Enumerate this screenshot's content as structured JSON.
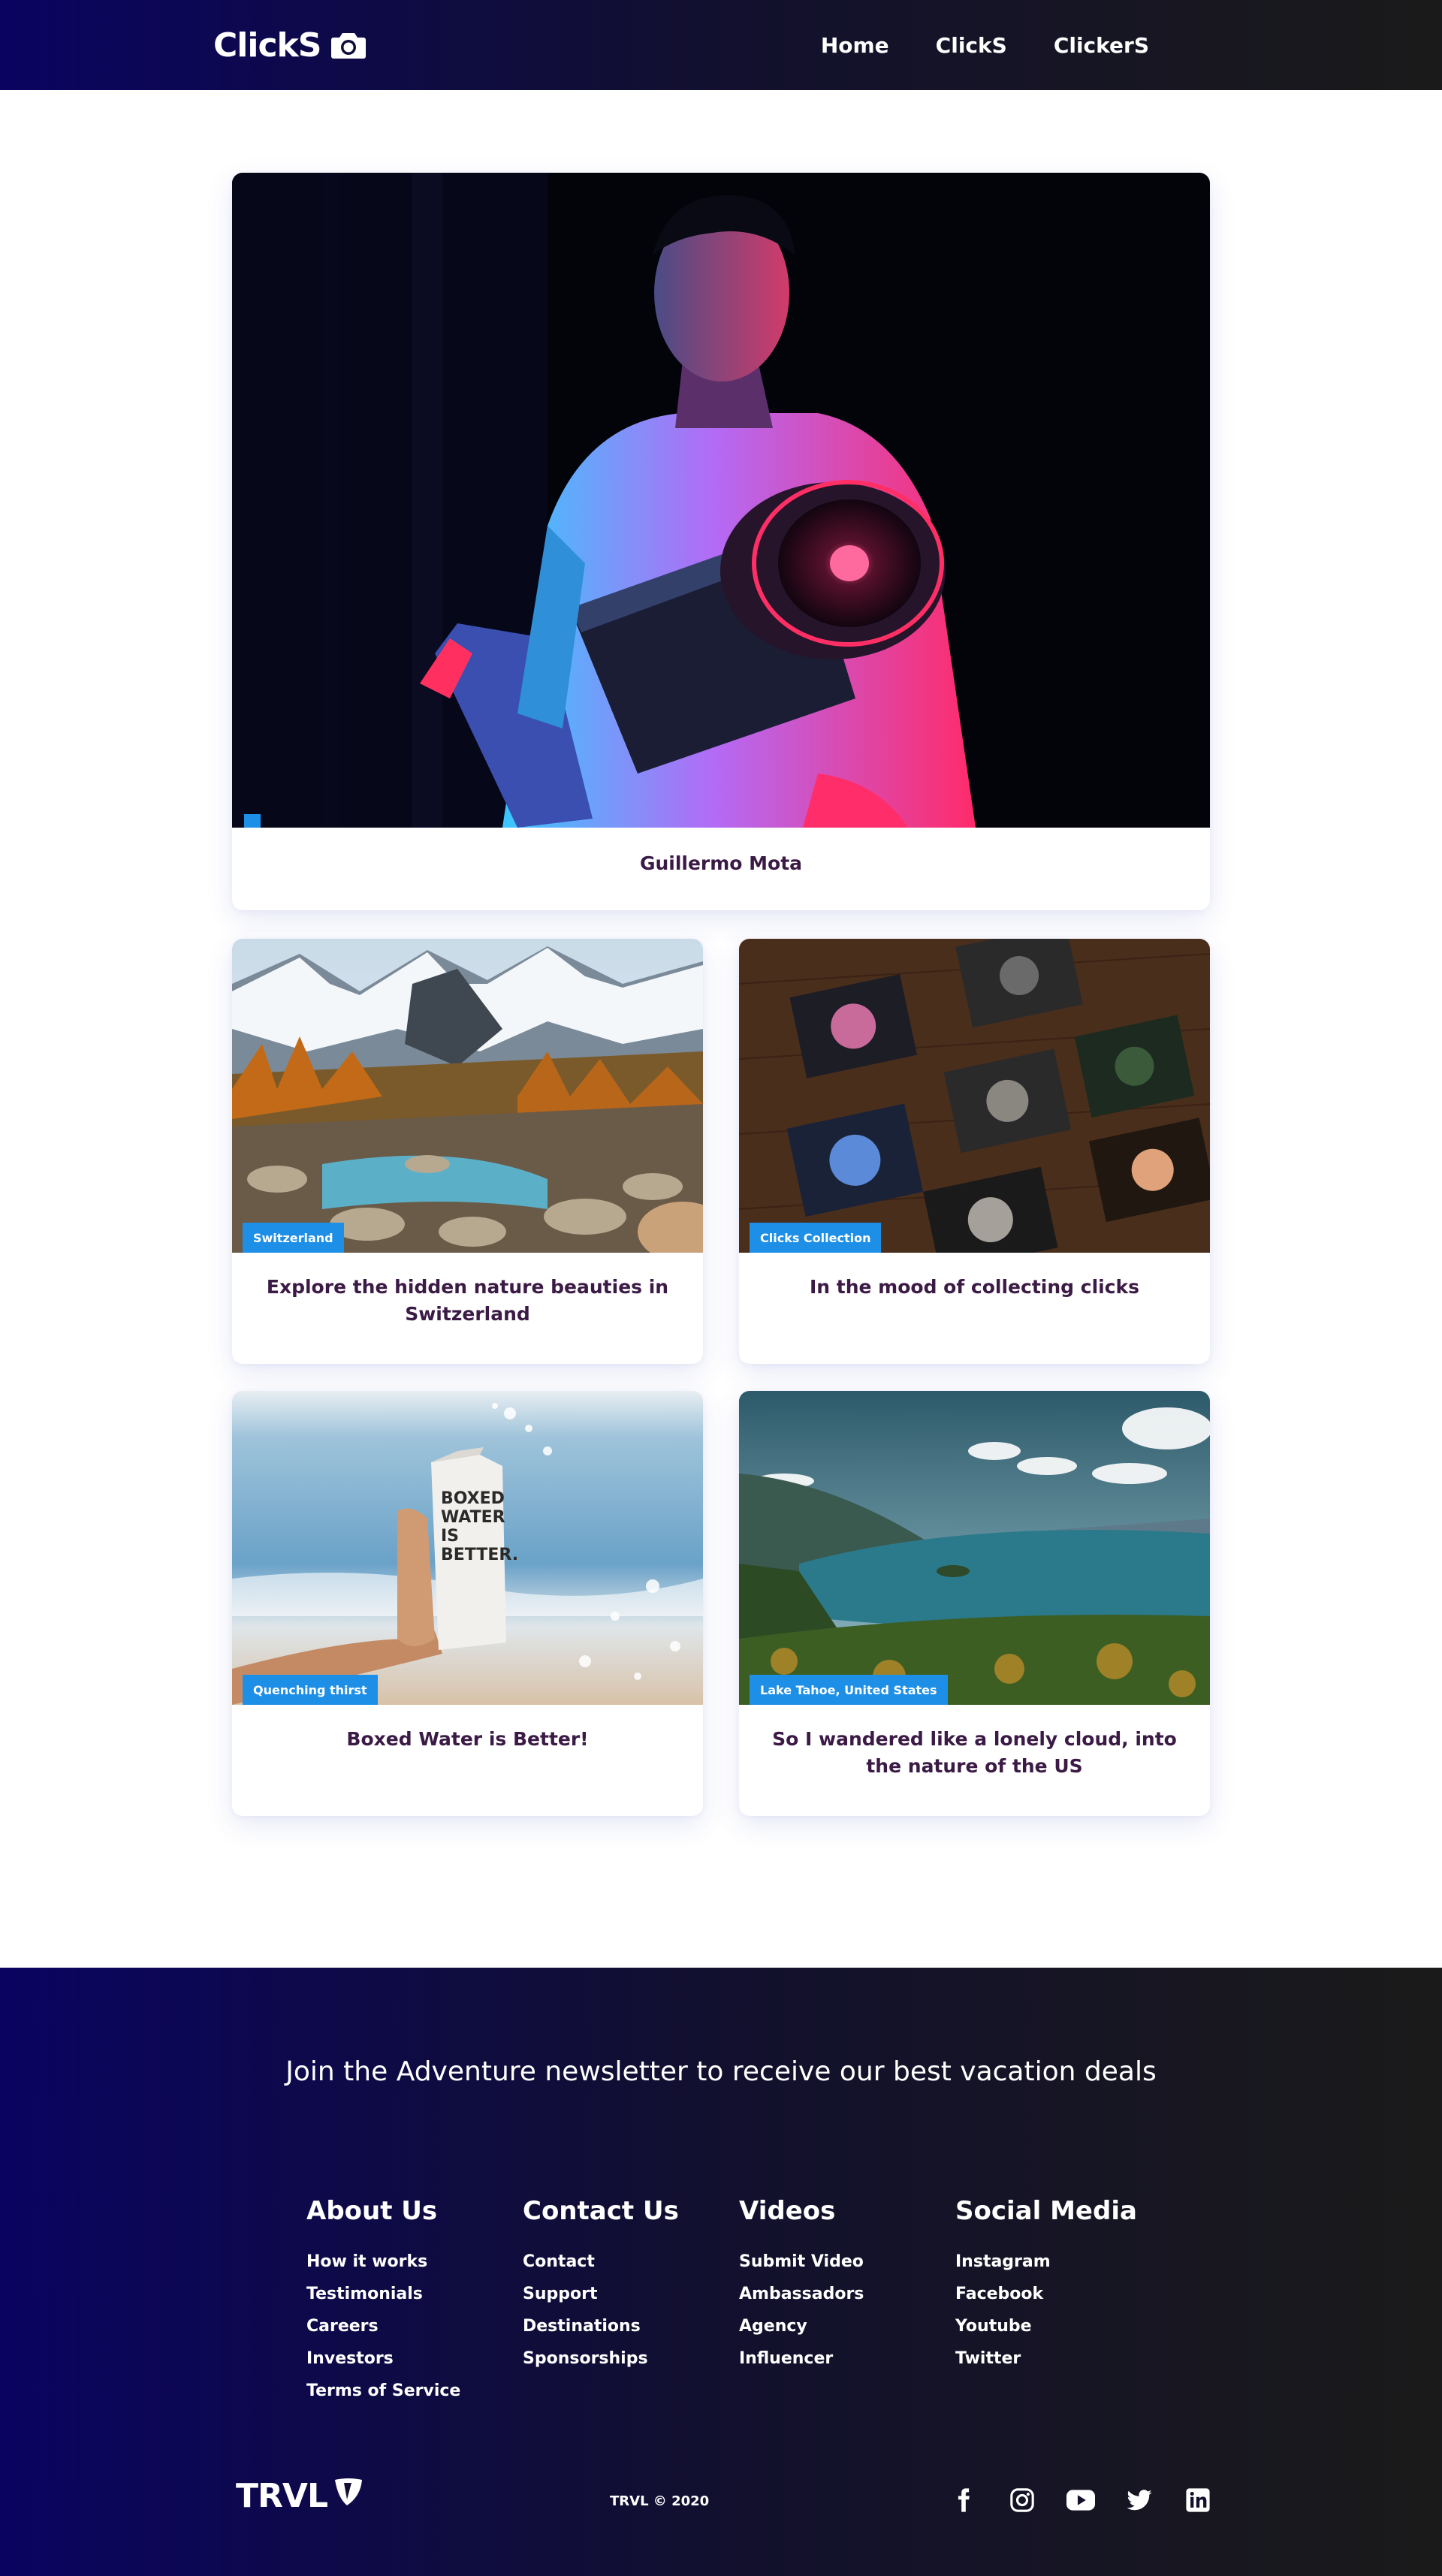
{
  "brand": {
    "name": "ClickS",
    "icon": "camera-icon"
  },
  "nav": {
    "items": [
      {
        "label": "Home"
      },
      {
        "label": "ClickS"
      },
      {
        "label": "ClickerS"
      }
    ]
  },
  "hero": {
    "title": "Guillermo Mota"
  },
  "cards": [
    {
      "tag": "Switzerland",
      "title": "Explore the hidden nature beauties in Switzerland"
    },
    {
      "tag": "Clicks Collection",
      "title": "In the mood of collecting clicks"
    },
    {
      "tag": "Quenching thirst",
      "title": "Boxed Water is Better!"
    },
    {
      "tag": "Lake Tahoe, United States",
      "title": "So I wandered like a lonely cloud, into the nature of the US"
    }
  ],
  "bottle_text": "BOXED WATER IS BETTER.",
  "footer": {
    "newsletter": "Join the Adventure newsletter to receive our best vacation deals",
    "columns": [
      {
        "heading": "About Us",
        "links": [
          "How it works",
          "Testimonials",
          "Careers",
          "Investors",
          "Terms of Service"
        ]
      },
      {
        "heading": "Contact Us",
        "links": [
          "Contact",
          "Support",
          "Destinations",
          "Sponsorships"
        ]
      },
      {
        "heading": "Videos",
        "links": [
          "Submit Video",
          "Ambassadors",
          "Agency",
          "Influencer"
        ]
      },
      {
        "heading": "Social Media",
        "links": [
          "Instagram",
          "Facebook",
          "Youtube",
          "Twitter"
        ]
      }
    ],
    "logo": "TRVL",
    "copyright": "TRVL © 2020",
    "social_icons": [
      "facebook-icon",
      "instagram-icon",
      "youtube-icon",
      "twitter-icon",
      "linkedin-icon"
    ]
  },
  "colors": {
    "nav_gradient_start": "#0a0460",
    "nav_gradient_end": "#1a1a1a",
    "tag_blue": "#1e8fe6",
    "title_purple": "#3b1a45"
  }
}
